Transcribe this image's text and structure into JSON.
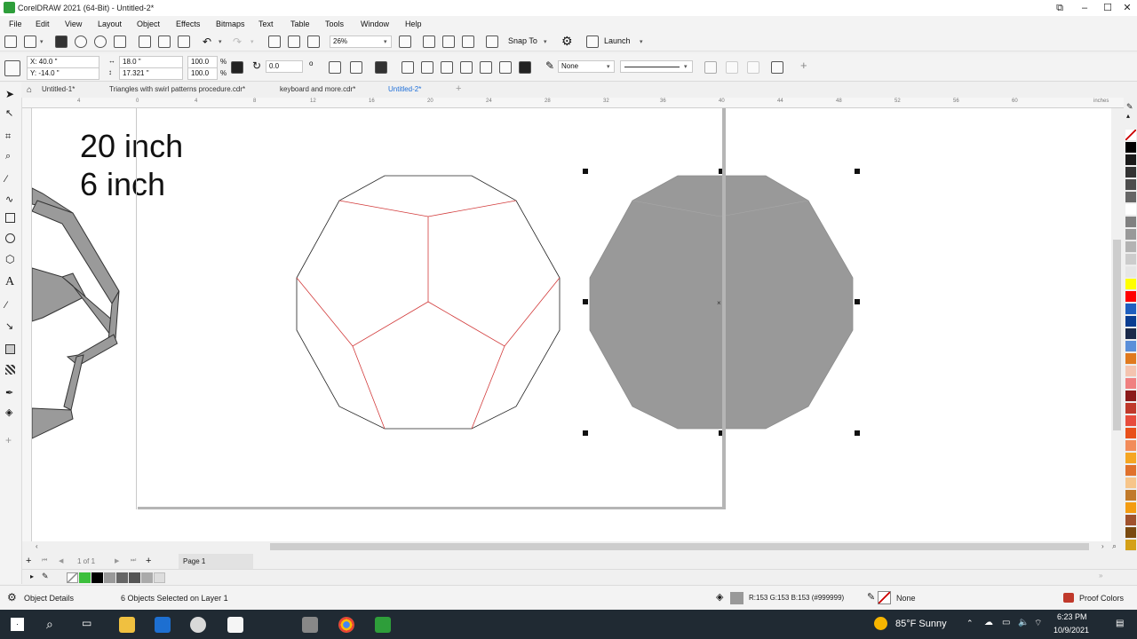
{
  "window": {
    "title": "CorelDRAW 2021 (64-Bit) - Untitled-2*",
    "controls": [
      "–",
      "☐",
      "✕"
    ]
  },
  "menu": [
    "File",
    "Edit",
    "View",
    "Layout",
    "Object",
    "Effects",
    "Bitmaps",
    "Text",
    "Table",
    "Tools",
    "Window",
    "Help"
  ],
  "toolbar": {
    "zoom": "26%",
    "snap_to": "Snap To",
    "launch": "Launch"
  },
  "properties": {
    "x": "X: 40.0 \"",
    "y": "Y: -14.0 \"",
    "width": "18.0 \"",
    "height": "17.321 \"",
    "scale_w": "100.0",
    "scale_h": "100.0",
    "percent": "%",
    "rotation": "0.0",
    "degree": "o",
    "outline_fill": "None"
  },
  "doc_tabs": [
    {
      "label": "Untitled-1*",
      "active": false
    },
    {
      "label": "Triangles with swirl patterns procedure.cdr*",
      "active": false
    },
    {
      "label": "keyboard and more.cdr*",
      "active": false
    },
    {
      "label": "Untitled-2*",
      "active": true
    }
  ],
  "ruler": {
    "units": "inches",
    "h_ticks": [
      "4",
      "0",
      "4",
      "8",
      "12",
      "16",
      "20",
      "24",
      "28",
      "32",
      "36",
      "40",
      "44",
      "48",
      "52",
      "56",
      "60"
    ]
  },
  "canvas_text": {
    "line1": "20 inch",
    "line2": "6 inch"
  },
  "page_nav": {
    "count": "1 of 1",
    "page_tab": "Page 1"
  },
  "status": {
    "object_details": "Object Details",
    "selection": "6 Objects Selected on Layer 1",
    "fill_color": "R:153 G:153 B:153 (#999999)",
    "outline": "None",
    "proof_colors": "Proof Colors"
  },
  "taskbar": {
    "weather": "85°F  Sunny",
    "time": "6:23 PM",
    "date": "10/9/2021"
  },
  "colors": {
    "selected_fill": "#999999",
    "edge_lines": "#d23b3b",
    "accent": "#1e6fd9"
  }
}
